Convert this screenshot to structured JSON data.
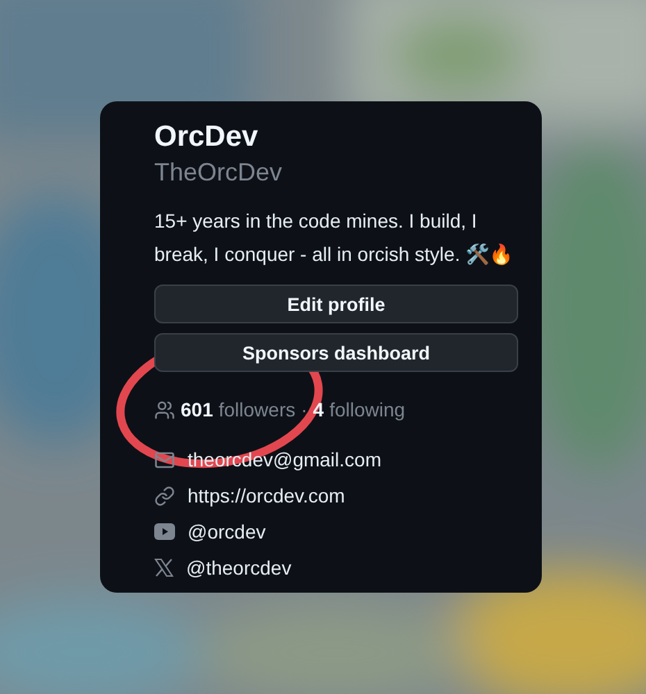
{
  "profile": {
    "name": "OrcDev",
    "username": "TheOrcDev",
    "bio": "15+ years in the code mines. I build, I break, I conquer - all in orcish style. 🛠️🔥"
  },
  "buttons": [
    {
      "label": "Edit profile"
    },
    {
      "label": "Sponsors dashboard"
    }
  ],
  "stats": {
    "followers_count": "601",
    "followers_label": "followers",
    "separator": "·",
    "following_count": "4",
    "following_label": "following"
  },
  "links": [
    {
      "kind": "email",
      "text": "theorcdev@gmail.com"
    },
    {
      "kind": "link",
      "text": "https://orcdev.com"
    },
    {
      "kind": "youtube",
      "text": "@orcdev"
    },
    {
      "kind": "x",
      "text": "@theorcdev"
    }
  ],
  "annotation": {
    "kind": "ellipse",
    "color": "#e2474f"
  }
}
